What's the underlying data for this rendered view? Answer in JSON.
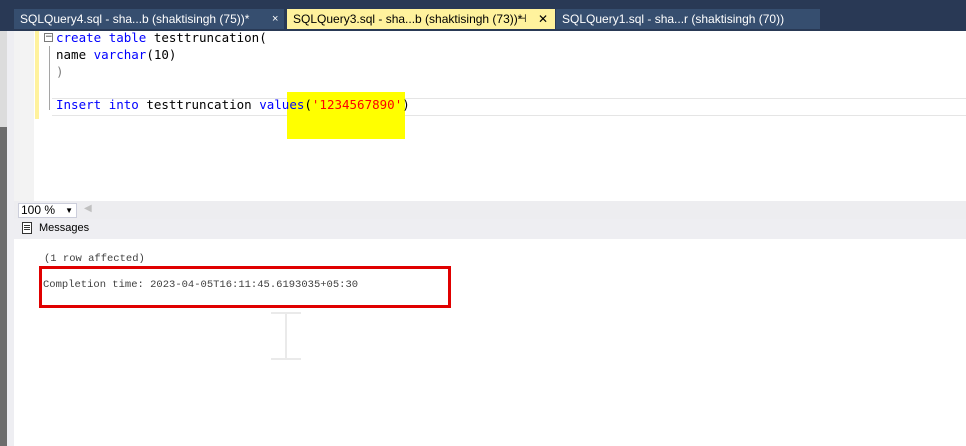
{
  "tabs": [
    {
      "label": "SQLQuery4.sql - sha...b (shaktisingh (75))*",
      "close": "×"
    },
    {
      "label": "SQLQuery3.sql - sha...b (shaktisingh (73))*",
      "pin": "⊣",
      "close": "✕"
    },
    {
      "label": "SQLQuery1.sql - sha...r (shaktisingh (70))"
    }
  ],
  "editor": {
    "collapse_glyph": "−",
    "line1_kw1": "create",
    "line1_kw2": "table",
    "line1_rest": " testtruncation(",
    "line2_name": "name ",
    "line2_type": "varchar",
    "line2_rest": "(10)",
    "line3": ")",
    "line5_kw1": "Insert",
    "line5_kw2": "into",
    "line5_table": " testtruncation ",
    "line5_kw3": "values",
    "line5_open": "(",
    "line5_str": "'1234567890'",
    "line5_close": ")"
  },
  "zoom": {
    "value": "100 %",
    "arrow": "▼",
    "scroll_arrow": "◀"
  },
  "results": {
    "tab_label": "Messages",
    "message1": "(1 row affected)",
    "message2": "Completion time: 2023-04-05T16:11:45.6193035+05:30"
  },
  "colors": {
    "tabstrip": "#293955",
    "active_tab": "#fff29d",
    "highlight": "#ffff00",
    "annotation_box": "#e00000"
  }
}
